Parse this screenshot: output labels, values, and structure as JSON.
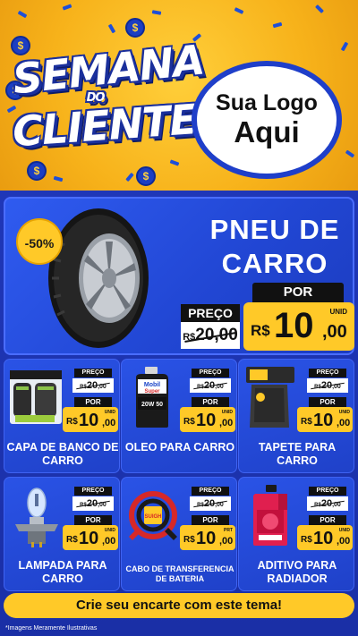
{
  "header": {
    "title_line1": "SEMANA",
    "title_line2": "DO",
    "title_line3": "CLIENTE",
    "logo_line1": "Sua Logo",
    "logo_line2": "Aqui"
  },
  "hero": {
    "discount": "-50%",
    "product_name": "PNEU DE CARRO",
    "old_label": "PREÇO",
    "old_currency": "R$",
    "old_value": "20,00",
    "new_label": "POR",
    "new_currency": "R$",
    "new_integer": "10",
    "new_decimal": ",00",
    "unit": "UNID"
  },
  "products": [
    {
      "name": "CAPA DE BANCO DE CARRO",
      "old_label": "PREÇO",
      "old_currency": "R$",
      "old_int": "20",
      "old_dec": ",00",
      "new_label": "POR",
      "new_currency": "R$",
      "new_int": "10",
      "new_dec": ",00",
      "unit": "UNID",
      "icon": "seat-cover-icon"
    },
    {
      "name": "OLEO PARA CARRO",
      "old_label": "PREÇO",
      "old_currency": "R$",
      "old_int": "20",
      "old_dec": ",00",
      "new_label": "POR",
      "new_currency": "R$",
      "new_int": "10",
      "new_dec": ",00",
      "unit": "UNID",
      "icon": "oil-bottle-icon",
      "brand": "Mobil Super",
      "grade": "20W 50"
    },
    {
      "name": "TAPETE PARA CARRO",
      "old_label": "PREÇO",
      "old_currency": "R$",
      "old_int": "20",
      "old_dec": ",00",
      "new_label": "POR",
      "new_currency": "R$",
      "new_int": "10",
      "new_dec": ",00",
      "unit": "UNID",
      "icon": "car-mat-icon"
    },
    {
      "name": "LAMPADA PARA CARRO",
      "old_label": "PREÇO",
      "old_currency": "R$",
      "old_int": "20",
      "old_dec": ",00",
      "new_label": "POR",
      "new_currency": "R$",
      "new_int": "10",
      "new_dec": ",00",
      "unit": "UNID",
      "icon": "headlight-bulb-icon"
    },
    {
      "name": "CABO DE TRANSFERENCIA DE BATERIA",
      "old_label": "PREÇO",
      "old_currency": "R$",
      "old_int": "20",
      "old_dec": ",00",
      "new_label": "POR",
      "new_currency": "R$",
      "new_int": "10",
      "new_dec": ",00",
      "unit": "PRT",
      "icon": "jumper-cable-icon"
    },
    {
      "name": "ADITIVO PARA RADIADOR",
      "old_label": "PREÇO",
      "old_currency": "R$",
      "old_int": "20",
      "old_dec": ",00",
      "new_label": "POR",
      "new_currency": "R$",
      "new_int": "10",
      "new_dec": ",00",
      "unit": "UNID",
      "icon": "radiator-additive-icon"
    }
  ],
  "banner": "Crie seu encarte com este tema!",
  "disclaimer": "*Imagens Meramente Ilustrativas",
  "colors": {
    "yellow": "#ffc928",
    "blue": "#1f37b8",
    "card_blue": "#2a53e6",
    "header_orange": "#f7b21a"
  }
}
